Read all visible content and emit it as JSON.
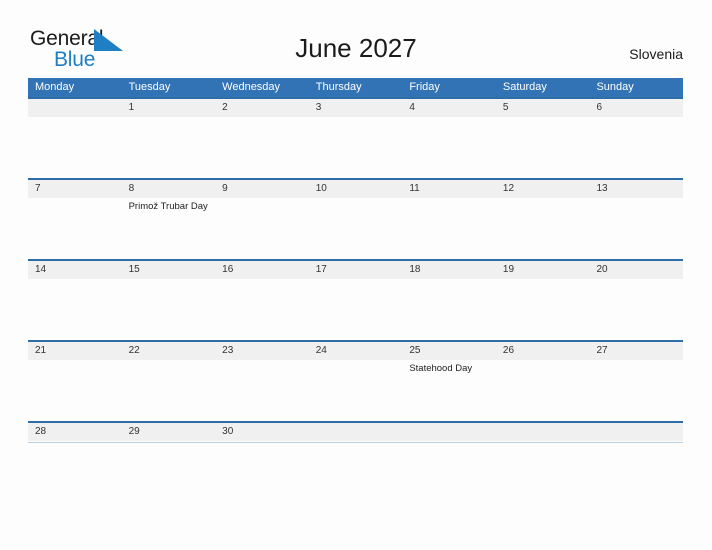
{
  "logo": {
    "word_one": "General",
    "word_two": "Blue",
    "flag_icon": "triangle-flag-icon",
    "blue": "#1e7fc4"
  },
  "header": {
    "title": "June 2027",
    "country": "Slovenia"
  },
  "colors": {
    "header_blue": "#3273b5",
    "row_border_blue": "#2e6da8",
    "day_band_gray": "#f0f0f0",
    "page_background": "#fdfdfd",
    "text_dark": "#1b1b1b"
  },
  "calendar": {
    "month": "June",
    "year": "2027",
    "weekdays": [
      "Monday",
      "Tuesday",
      "Wednesday",
      "Thursday",
      "Friday",
      "Saturday",
      "Sunday"
    ],
    "weeks": [
      {
        "days": [
          {
            "number": "",
            "event": ""
          },
          {
            "number": "1",
            "event": ""
          },
          {
            "number": "2",
            "event": ""
          },
          {
            "number": "3",
            "event": ""
          },
          {
            "number": "4",
            "event": ""
          },
          {
            "number": "5",
            "event": ""
          },
          {
            "number": "6",
            "event": ""
          }
        ]
      },
      {
        "days": [
          {
            "number": "7",
            "event": ""
          },
          {
            "number": "8",
            "event": "Primož Trubar Day"
          },
          {
            "number": "9",
            "event": ""
          },
          {
            "number": "10",
            "event": ""
          },
          {
            "number": "11",
            "event": ""
          },
          {
            "number": "12",
            "event": ""
          },
          {
            "number": "13",
            "event": ""
          }
        ]
      },
      {
        "days": [
          {
            "number": "14",
            "event": ""
          },
          {
            "number": "15",
            "event": ""
          },
          {
            "number": "16",
            "event": ""
          },
          {
            "number": "17",
            "event": ""
          },
          {
            "number": "18",
            "event": ""
          },
          {
            "number": "19",
            "event": ""
          },
          {
            "number": "20",
            "event": ""
          }
        ]
      },
      {
        "days": [
          {
            "number": "21",
            "event": ""
          },
          {
            "number": "22",
            "event": ""
          },
          {
            "number": "23",
            "event": ""
          },
          {
            "number": "24",
            "event": ""
          },
          {
            "number": "25",
            "event": "Statehood Day"
          },
          {
            "number": "26",
            "event": ""
          },
          {
            "number": "27",
            "event": ""
          }
        ]
      },
      {
        "days": [
          {
            "number": "28",
            "event": ""
          },
          {
            "number": "29",
            "event": ""
          },
          {
            "number": "30",
            "event": ""
          },
          {
            "number": "",
            "event": ""
          },
          {
            "number": "",
            "event": ""
          },
          {
            "number": "",
            "event": ""
          },
          {
            "number": "",
            "event": ""
          }
        ]
      }
    ]
  }
}
